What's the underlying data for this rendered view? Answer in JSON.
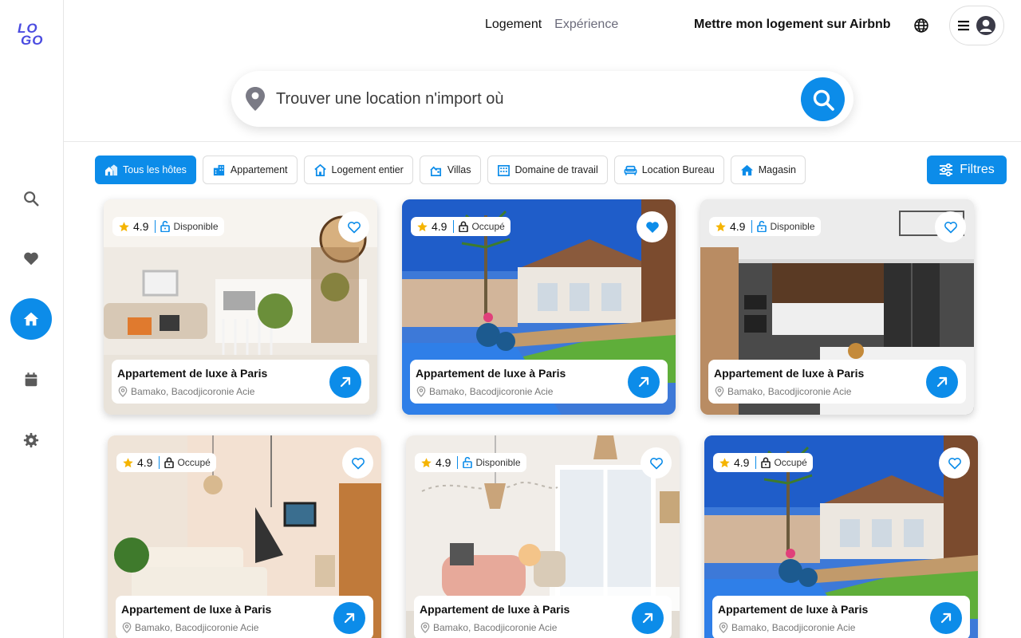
{
  "colors": {
    "accent": "#0c8ce9",
    "logo": "#4a4be0",
    "star": "#f5b400"
  },
  "logo": {
    "line1": "LO",
    "line2": "GO"
  },
  "sidebar": {
    "items": [
      {
        "name": "search-icon"
      },
      {
        "name": "heart-icon"
      },
      {
        "name": "home-icon",
        "active": true
      },
      {
        "name": "calendar-icon"
      },
      {
        "name": "gear-icon"
      }
    ]
  },
  "header": {
    "tabs": [
      {
        "label": "Logement",
        "active": true
      },
      {
        "label": "Expérience",
        "active": false
      }
    ],
    "host_link": "Mettre mon logement sur Airbnb"
  },
  "search": {
    "placeholder": "Trouver une location n'import où"
  },
  "filters": {
    "chips": [
      {
        "label": "Tous les hôtes",
        "active": true
      },
      {
        "label": "Appartement"
      },
      {
        "label": "Logement entier"
      },
      {
        "label": "Villas"
      },
      {
        "label": "Domaine de travail"
      },
      {
        "label": "Location Bureau"
      },
      {
        "label": "Magasin"
      }
    ],
    "filters_button": "Filtres"
  },
  "listings": [
    {
      "rating": "4.9",
      "status": "Disponible",
      "favorited": false,
      "title": "Appartement de luxe à Paris",
      "location": "Bamako, Bacodjicoronie Acie",
      "photo": "living-room"
    },
    {
      "rating": "4.9",
      "status": "Occupé",
      "favorited": true,
      "title": "Appartement de luxe à Paris",
      "location": "Bamako, Bacodjicoronie Acie",
      "photo": "villa-pool"
    },
    {
      "rating": "4.9",
      "status": "Disponible",
      "favorited": false,
      "title": "Appartement de luxe à Paris",
      "location": "Bamako, Bacodjicoronie Acie",
      "photo": "kitchen"
    },
    {
      "rating": "4.9",
      "status": "Occupé",
      "favorited": false,
      "title": "Appartement de luxe à Paris",
      "location": "Bamako, Bacodjicoronie Acie",
      "photo": "bedroom"
    },
    {
      "rating": "4.9",
      "status": "Disponible",
      "favorited": false,
      "title": "Appartement de luxe à Paris",
      "location": "Bamako, Bacodjicoronie Acie",
      "photo": "lounge"
    },
    {
      "rating": "4.9",
      "status": "Occupé",
      "favorited": false,
      "title": "Appartement de luxe à Paris",
      "location": "Bamako, Bacodjicoronie Acie",
      "photo": "villa-pool"
    }
  ]
}
